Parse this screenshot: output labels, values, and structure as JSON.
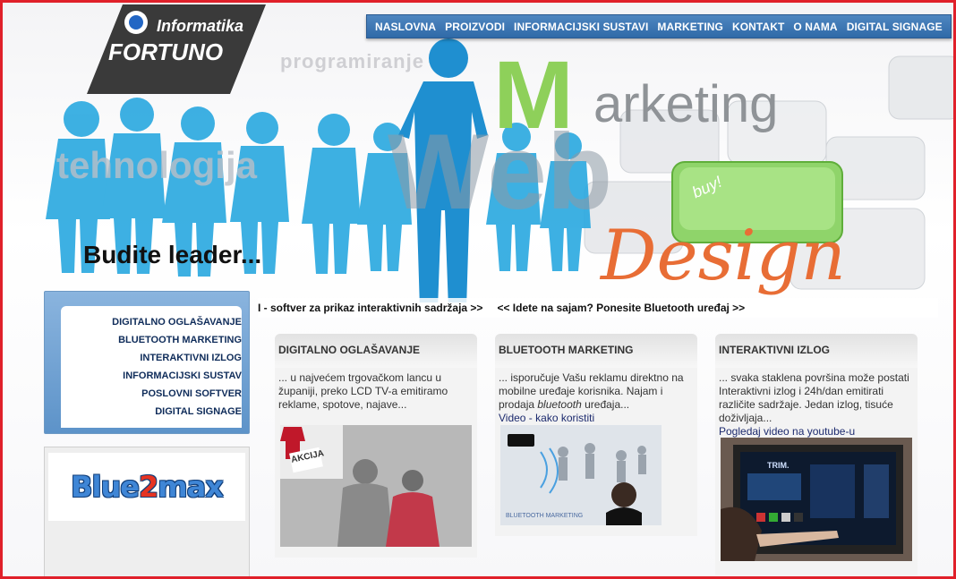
{
  "logo": {
    "brand": "Informatika",
    "name": "FORTUNO"
  },
  "nav": {
    "items": [
      "NASLOVNA",
      "PROIZVODI",
      "INFORMACIJSKI SUSTAVI",
      "MARKETING",
      "KONTAKT",
      "O NAMA",
      "DIGITAL SIGNAGE"
    ]
  },
  "hero": {
    "word_programiranje": "programiranje",
    "word_tehnologija": "tehnologija",
    "word_web": "Web",
    "word_m": "M",
    "word_arketing": "arketing",
    "word_design": "Design",
    "slogan": "Budite leader...",
    "buy_key": "buy!"
  },
  "ticker": {
    "item1": "І - softver za prikaz interaktivnih sadržaja >>",
    "item2": "<< Idete na sajam? Ponesite Bluetooth uređaj >>"
  },
  "side_menu": {
    "items": [
      "DIGITALNO OGLAŠAVANJE",
      "BLUETOOTH MARKETING",
      "INTERAKTIVNI IZLOG",
      "INFORMACIJSKI SUSTAV",
      "POSLOVNI SOFTVER",
      "DIGITAL SIGNAGE"
    ]
  },
  "partner": {
    "logo_part1": "Blue",
    "logo_part2": "2",
    "logo_part3": "max"
  },
  "cards": [
    {
      "title": "DIGITALNO OGLAŠAVANJE",
      "text": "... u najvećem trgovačkom lancu u županiji, preko LCD TV-a emitiramo reklame, spotove, najave...",
      "link": "",
      "image_label": "AKCIJA"
    },
    {
      "title": "BLUETOOTH MARKETING",
      "text_before": "... isporučuje Vašu reklamu direktno na mobilne uređaje korisnika. Najam i prodaja ",
      "text_em": "bluetooth",
      "text_after": " uređaja...",
      "link": "Video - kako koristiti",
      "image_label": "BLUETOOTH MARKETING"
    },
    {
      "title": "INTERAKTIVNI IZLOG",
      "text": "... svaka staklena površina može postati Interaktivni izlog i 24h/dan emitirati različite sadržaje. Jedan izlog, tisuće doživljaja...",
      "link": "Pogledaj video na youtube-u",
      "image_label": "TRIM."
    }
  ]
}
